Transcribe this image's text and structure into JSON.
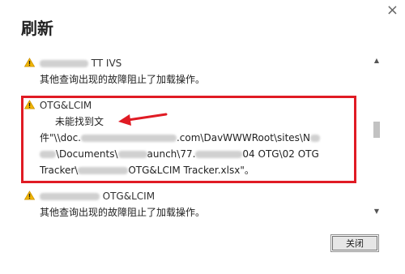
{
  "dialog": {
    "title": "刷新",
    "close_glyph": "×",
    "close_button_label": "关闭"
  },
  "entries": [
    {
      "source_suffix": "TT IVS",
      "message": "其他查询出现的故障阻止了加载操作。"
    },
    {
      "source": "OTG&LCIM",
      "error_line1": "未能找到文",
      "error_line2_prefix": "件\"\\\\doc.",
      "error_line2_suffix": ".com\\DavWWWRoot\\sites\\N",
      "error_line3_prefix": "\\Documents\\",
      "error_line3_mid": "aunch\\77.",
      "error_line3_suffix": "04 OTG\\02 OTG",
      "error_line4_prefix": "Tracker\\",
      "error_line4_suffix": "OTG&LCIM Tracker.xlsx\"。"
    },
    {
      "source_suffix": "OTG&LCIM",
      "message": "其他查询出现的故障阻止了加载操作。"
    }
  ],
  "icons": {
    "warning": "warning-icon",
    "arrow": "red-annotation-arrow"
  },
  "colors": {
    "highlight": "#e01b24",
    "warning_fill": "#f2b600"
  }
}
